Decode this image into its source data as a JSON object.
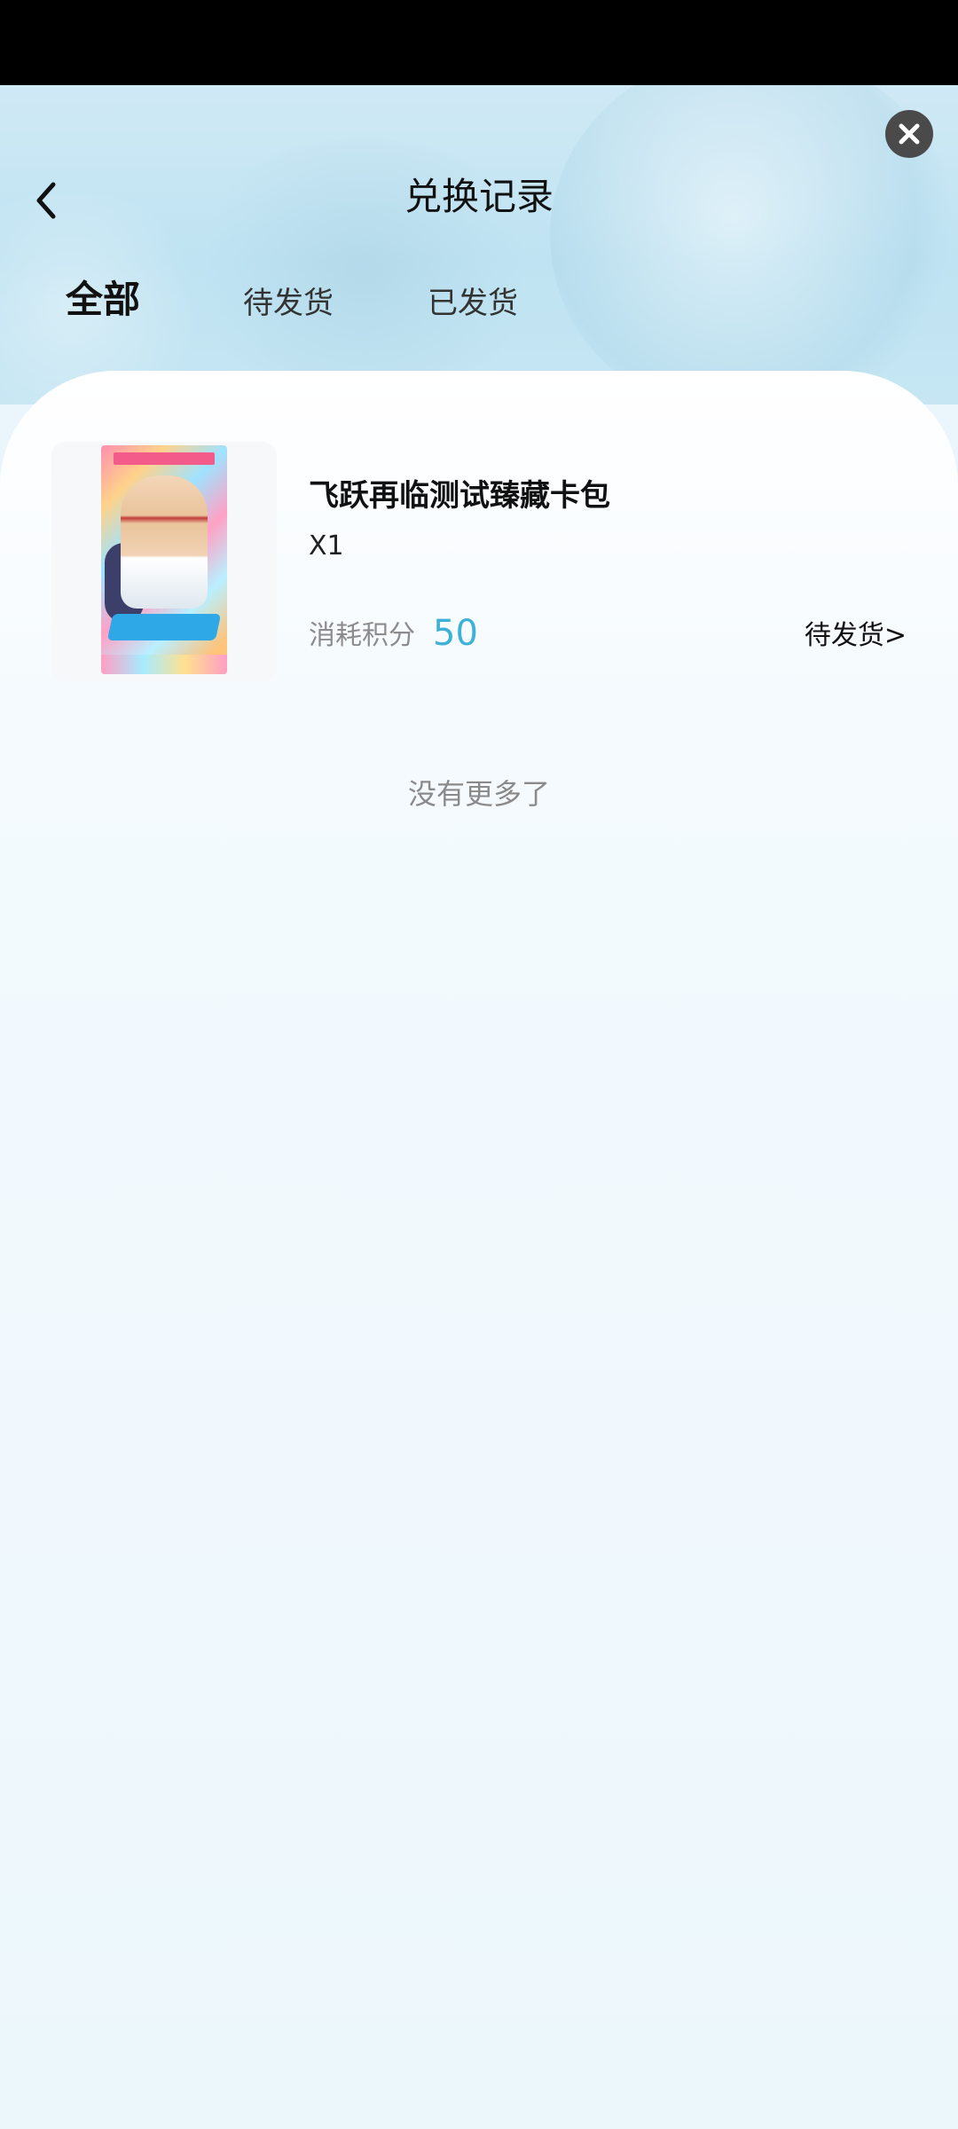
{
  "header": {
    "title": "兑换记录",
    "back_icon": "chevron-left-icon",
    "close_icon": "close-icon"
  },
  "tabs": [
    {
      "label": "全部",
      "active": true
    },
    {
      "label": "待发货",
      "active": false
    },
    {
      "label": "已发货",
      "active": false
    }
  ],
  "records": [
    {
      "title": "飞跃再临测试臻藏卡包",
      "quantity": "X1",
      "cost_label": "消耗积分",
      "cost_value": "50",
      "status": "待发货>"
    }
  ],
  "list_end_text": "没有更多了",
  "colors": {
    "accent": "#3db1d6",
    "header_bg": "#c6e6f3",
    "page_bg": "#eaf6fc"
  }
}
